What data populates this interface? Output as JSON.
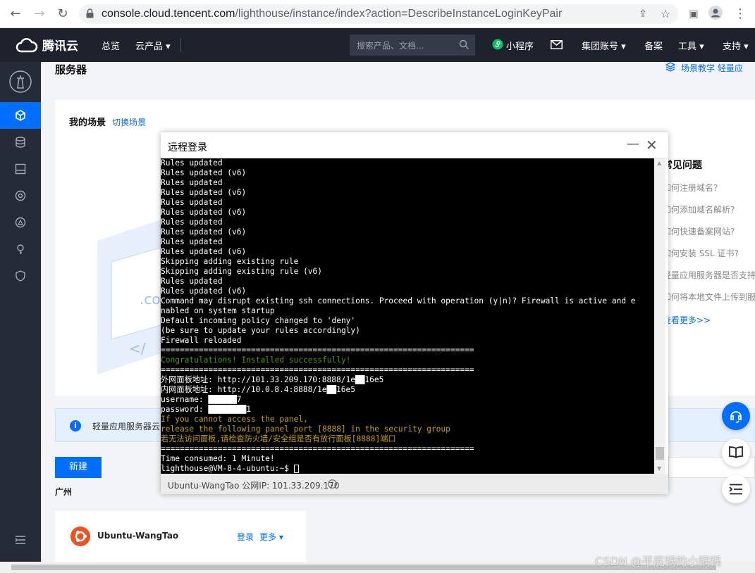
{
  "browser": {
    "url_host": "console.cloud.tencent.com",
    "url_path": "/lighthouse/instance/index?action=DescribeInstanceLoginKeyPair"
  },
  "topnav": {
    "brand": "腾讯云",
    "items": [
      "总览",
      "云产品 ▾",
      "小程序",
      "集团账号 ▾",
      "备案",
      "工具 ▾",
      "支持 ▾"
    ],
    "search_placeholder": "搜索产品、文档..."
  },
  "main": {
    "title": "服务器",
    "right_links": "场景教学   轻量应",
    "scene_title": "我的场景",
    "switch_scene": "切换场景",
    "faq_heading": "常见问题",
    "faq_items": [
      "如何注册域名?",
      "如何添加域名解析?",
      "如何快速备案网站?",
      "如何安装 SSL 证书?",
      "轻量应用服务器是否支持",
      "如何将本地文件上传到服"
    ],
    "faq_more": "查看更多>>",
    "info_text": "轻量应用服务器云",
    "new_button": "新建",
    "region": "广州",
    "instance_name": "Ubuntu-WangTao",
    "login_link": "登录",
    "more_link": "更多 ▾"
  },
  "modal": {
    "title": "远程登录",
    "footer": "Ubuntu-WangTao 公网IP: 101.33.209.170",
    "terminal_lines": [
      {
        "t": "Rules updated",
        "c": ""
      },
      {
        "t": "Rules updated (v6)",
        "c": ""
      },
      {
        "t": "Rules updated",
        "c": ""
      },
      {
        "t": "Rules updated (v6)",
        "c": ""
      },
      {
        "t": "Rules updated",
        "c": ""
      },
      {
        "t": "Rules updated (v6)",
        "c": ""
      },
      {
        "t": "Rules updated",
        "c": ""
      },
      {
        "t": "Rules updated (v6)",
        "c": ""
      },
      {
        "t": "Rules updated",
        "c": ""
      },
      {
        "t": "Rules updated (v6)",
        "c": ""
      },
      {
        "t": "Skipping adding existing rule",
        "c": ""
      },
      {
        "t": "Skipping adding existing rule (v6)",
        "c": ""
      },
      {
        "t": "Rules updated",
        "c": ""
      },
      {
        "t": "Rules updated (v6)",
        "c": ""
      },
      {
        "t": "Command may disrupt existing ssh connections. Proceed with operation (y|n)? Firewall is active and e",
        "c": ""
      },
      {
        "t": "nabled on system startup",
        "c": ""
      },
      {
        "t": "Default incoming policy changed to 'deny'",
        "c": ""
      },
      {
        "t": "(be sure to update your rules accordingly)",
        "c": ""
      },
      {
        "t": "Firewall reloaded",
        "c": ""
      },
      {
        "t": "==================================================================",
        "c": ""
      },
      {
        "t": "Congratulations! Installed successfully!",
        "c": "g"
      },
      {
        "t": "==================================================================",
        "c": ""
      },
      {
        "t": "外网面板地址: http://101.33.209.170:8888/1e██16e5",
        "c": ""
      },
      {
        "t": "内网面板地址: http://10.0.8.4:8888/1e██16e5",
        "c": ""
      },
      {
        "t": "username: ██████7",
        "c": ""
      },
      {
        "t": "password: ████████1",
        "c": ""
      },
      {
        "t": "If you cannot access the panel,",
        "c": "y"
      },
      {
        "t": "release the following panel port [8888] in the security group",
        "c": "y"
      },
      {
        "t": "若无法访问面板,请检查防火墙/安全组是否有放行面板[8888]端口",
        "c": "y"
      },
      {
        "t": "==================================================================",
        "c": ""
      },
      {
        "t": "Time consumed: 1 Minute!",
        "c": ""
      },
      {
        "t": "lighthouse@VM-8-4-ubuntu:~$ ",
        "c": ""
      }
    ]
  },
  "watermark": "CSDN @平底锅的小锅锅"
}
